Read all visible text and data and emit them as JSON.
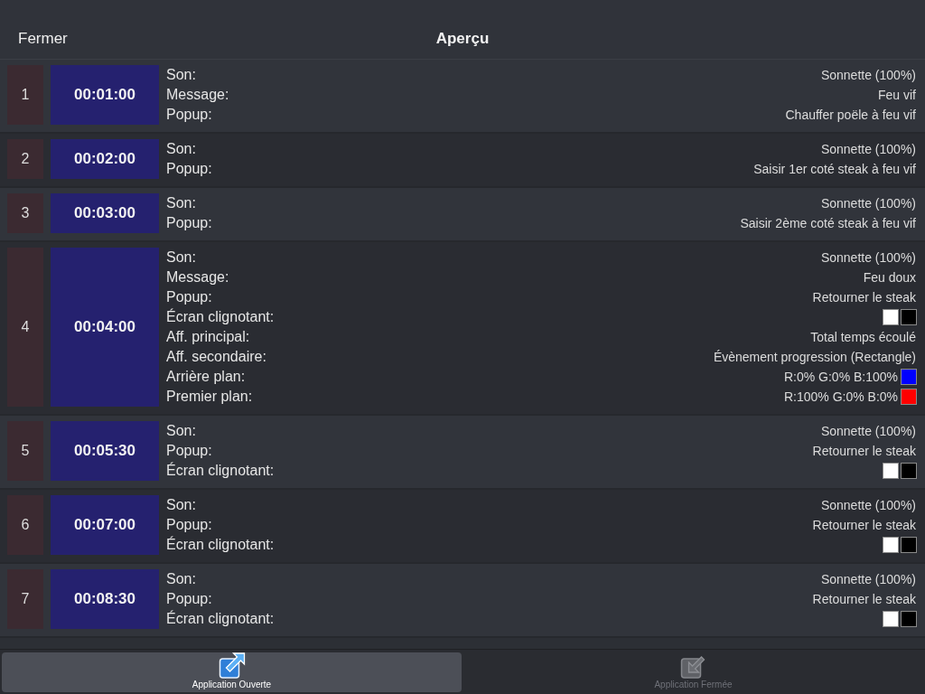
{
  "header": {
    "close": "Fermer",
    "title": "Aperçu"
  },
  "events": [
    {
      "number": "1",
      "time": "00:01:00",
      "fields": [
        {
          "label": "Son:",
          "value": "Sonnette (100%)"
        },
        {
          "label": "Message:",
          "value": "Feu vif"
        },
        {
          "label": "Popup:",
          "value": "Chauffer poële à feu vif"
        }
      ]
    },
    {
      "number": "2",
      "time": "00:02:00",
      "fields": [
        {
          "label": "Son:",
          "value": "Sonnette (100%)"
        },
        {
          "label": "Popup:",
          "value": "Saisir 1er coté steak à feu vif"
        }
      ]
    },
    {
      "number": "3",
      "time": "00:03:00",
      "fields": [
        {
          "label": "Son:",
          "value": "Sonnette (100%)"
        },
        {
          "label": "Popup:",
          "value": "Saisir 2ème coté steak à feu vif"
        }
      ]
    },
    {
      "number": "4",
      "time": "00:04:00",
      "fields": [
        {
          "label": "Son:",
          "value": "Sonnette (100%)"
        },
        {
          "label": "Message:",
          "value": "Feu doux"
        },
        {
          "label": "Popup:",
          "value": "Retourner le steak"
        },
        {
          "label": "Écran clignotant:",
          "swatches": [
            {
              "color": "#ffffff"
            },
            {
              "color": "#000000"
            }
          ]
        },
        {
          "label": "Aff. principal:",
          "value": "Total temps écoulé"
        },
        {
          "label": "Aff. secondaire:",
          "value": "Évènement progression (Rectangle)"
        },
        {
          "label": "Arrière plan:",
          "value": "R:0% G:0% B:100%",
          "swatches": [
            {
              "color": "#0000ff"
            }
          ]
        },
        {
          "label": "Premier plan:",
          "value": "R:100% G:0% B:0%",
          "swatches": [
            {
              "color": "#ff0000"
            }
          ]
        }
      ]
    },
    {
      "number": "5",
      "time": "00:05:30",
      "fields": [
        {
          "label": "Son:",
          "value": "Sonnette (100%)"
        },
        {
          "label": "Popup:",
          "value": "Retourner le steak"
        },
        {
          "label": "Écran clignotant:",
          "swatches": [
            {
              "color": "#ffffff"
            },
            {
              "color": "#000000"
            }
          ]
        }
      ]
    },
    {
      "number": "6",
      "time": "00:07:00",
      "fields": [
        {
          "label": "Son:",
          "value": "Sonnette (100%)"
        },
        {
          "label": "Popup:",
          "value": "Retourner le steak"
        },
        {
          "label": "Écran clignotant:",
          "swatches": [
            {
              "color": "#ffffff"
            },
            {
              "color": "#000000"
            }
          ]
        }
      ]
    },
    {
      "number": "7",
      "time": "00:08:30",
      "fields": [
        {
          "label": "Son:",
          "value": "Sonnette (100%)"
        },
        {
          "label": "Popup:",
          "value": "Retourner le steak"
        },
        {
          "label": "Écran clignotant:",
          "swatches": [
            {
              "color": "#ffffff"
            },
            {
              "color": "#000000"
            }
          ]
        }
      ]
    }
  ],
  "tab_bar": [
    {
      "label": "Application Ouverte",
      "selected": true
    },
    {
      "label": "Application Fermée",
      "selected": false
    }
  ]
}
